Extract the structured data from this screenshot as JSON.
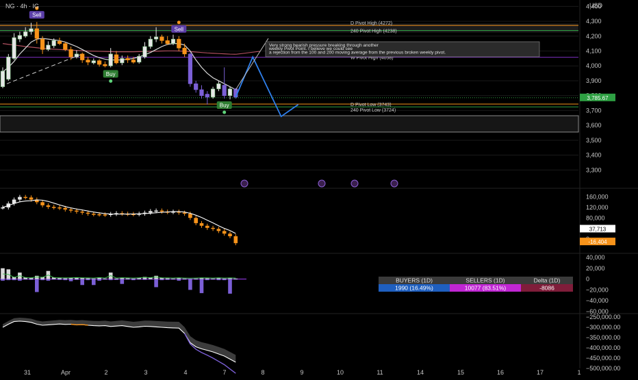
{
  "header": {
    "symbol": "NG · 4h · IG",
    "currency": "USD"
  },
  "colors": {
    "bg": "#000000",
    "up": "#e6e6e6",
    "down": "#f7931a",
    "buy": "#7b5fd6",
    "pivot": "#f7931a",
    "ma": "#d9d9d9",
    "projection": "#2f80ed",
    "accent": "#7b2fbf",
    "grid": "#1a1a1a"
  },
  "chart_data": [
    {
      "type": "candlestick",
      "title": "",
      "ylim": [
        3200,
        4420
      ],
      "y_ticks": [
        "4,400",
        "4,300",
        "4,200",
        "4,100",
        "4,000",
        "3,900",
        "3,800",
        "3,700",
        "3,600",
        "3,500",
        "3,400",
        "3,300"
      ],
      "x_ticks": [
        "31",
        "Apr",
        "2",
        "3",
        "4",
        "7",
        "8",
        "9",
        "10",
        "11",
        "14",
        "15",
        "16",
        "17",
        "1"
      ],
      "last_price": "3,785.67",
      "candles": [
        {
          "o": 3860,
          "c": 3965,
          "h": 3990,
          "l": 3850
        },
        {
          "o": 3910,
          "c": 4060,
          "h": 4080,
          "l": 3900
        },
        {
          "o": 4050,
          "c": 4190,
          "h": 4220,
          "l": 4040
        },
        {
          "o": 4180,
          "c": 4205,
          "h": 4230,
          "l": 4160
        },
        {
          "o": 4200,
          "c": 4230,
          "h": 4260,
          "l": 4190
        },
        {
          "o": 4230,
          "c": 4250,
          "h": 4290,
          "l": 4210
        },
        {
          "o": 4250,
          "c": 4185,
          "h": 4295,
          "l": 4150
        },
        {
          "o": 4180,
          "c": 4110,
          "h": 4200,
          "l": 4080
        },
        {
          "o": 4110,
          "c": 4140,
          "h": 4165,
          "l": 4100
        },
        {
          "o": 4135,
          "c": 4170,
          "h": 4185,
          "l": 4120
        },
        {
          "o": 4165,
          "c": 4150,
          "h": 4190,
          "l": 4140
        },
        {
          "o": 4150,
          "c": 4110,
          "h": 4160,
          "l": 4100
        },
        {
          "o": 4110,
          "c": 4060,
          "h": 4130,
          "l": 4040
        },
        {
          "o": 4060,
          "c": 4080,
          "h": 4105,
          "l": 4050
        },
        {
          "o": 4080,
          "c": 4040,
          "h": 4090,
          "l": 4020
        },
        {
          "o": 4040,
          "c": 4025,
          "h": 4060,
          "l": 4005
        },
        {
          "o": 4020,
          "c": 4035,
          "h": 4050,
          "l": 4010
        },
        {
          "o": 4035,
          "c": 4010,
          "h": 4045,
          "l": 3995
        },
        {
          "o": 4010,
          "c": 4000,
          "h": 4030,
          "l": 3990
        },
        {
          "o": 4000,
          "c": 4080,
          "h": 4120,
          "l": 3990
        },
        {
          "o": 4075,
          "c": 4020,
          "h": 4100,
          "l": 4010
        },
        {
          "o": 4020,
          "c": 4050,
          "h": 4070,
          "l": 4005
        },
        {
          "o": 4050,
          "c": 4040,
          "h": 4070,
          "l": 4020
        },
        {
          "o": 4040,
          "c": 4025,
          "h": 4060,
          "l": 4015
        },
        {
          "o": 4025,
          "c": 4065,
          "h": 4080,
          "l": 4015
        },
        {
          "o": 4060,
          "c": 4130,
          "h": 4160,
          "l": 4050
        },
        {
          "o": 4130,
          "c": 4180,
          "h": 4200,
          "l": 4115
        },
        {
          "o": 4180,
          "c": 4195,
          "h": 4260,
          "l": 4160
        },
        {
          "o": 4195,
          "c": 4170,
          "h": 4210,
          "l": 4150
        },
        {
          "o": 4170,
          "c": 4150,
          "h": 4200,
          "l": 4140
        },
        {
          "o": 4150,
          "c": 4180,
          "h": 4210,
          "l": 4140
        },
        {
          "o": 4180,
          "c": 4120,
          "h": 4200,
          "l": 4100
        },
        {
          "o": 4120,
          "c": 4080,
          "h": 4150,
          "l": 4060
        },
        {
          "o": 4080,
          "c": 3880,
          "h": 4090,
          "l": 3860
        },
        {
          "o": 3880,
          "c": 3840,
          "h": 3900,
          "l": 3820
        },
        {
          "o": 3840,
          "c": 3800,
          "h": 3870,
          "l": 3780
        },
        {
          "o": 3810,
          "c": 3790,
          "h": 3830,
          "l": 3740
        },
        {
          "o": 3790,
          "c": 3845,
          "h": 3860,
          "l": 3780
        },
        {
          "o": 3845,
          "c": 3880,
          "h": 3900,
          "l": 3830
        },
        {
          "o": 3870,
          "c": 3800,
          "h": 3990,
          "l": 3780
        },
        {
          "o": 3800,
          "c": 3845,
          "h": 3860,
          "l": 3775
        },
        {
          "o": 3845,
          "c": 3790,
          "h": 3850,
          "l": 3780
        }
      ],
      "ma": [
        3960,
        3990,
        4030,
        4080,
        4120,
        4160,
        4180,
        4185,
        4180,
        4175,
        4170,
        4160,
        4145,
        4130,
        4110,
        4090,
        4070,
        4055,
        4045,
        4040,
        4040,
        4040,
        4045,
        4050,
        4060,
        4075,
        4090,
        4110,
        4130,
        4145,
        4150,
        4150,
        4140,
        4100,
        4040,
        3990,
        3950,
        3920,
        3900,
        3880,
        3860,
        3840
      ],
      "long_ma": [
        4150,
        4145,
        4140,
        4135,
        4130,
        4126,
        4122,
        4118,
        4115,
        4112,
        4110,
        4108,
        4106,
        4104,
        4102,
        4100,
        4099,
        4098,
        4097,
        4096,
        4095,
        4095,
        4095,
        4095,
        4096,
        4097,
        4098,
        4099,
        4100,
        4101,
        4101,
        4100,
        4099,
        4096,
        4093,
        4090,
        4087,
        4085,
        4083,
        4081,
        4079,
        4078
      ],
      "levels": [
        {
          "label": "D Pivot High (4272)",
          "value": 4272
        },
        {
          "label": "240 Pivot High (4238)",
          "value": 4238
        },
        {
          "label": "W Pivot High (4058)",
          "value": 4058
        },
        {
          "label": "D Pivot Low (3743)",
          "value": 3743
        },
        {
          "label": "240 Pivot Low (3724)",
          "value": 3724
        }
      ],
      "projection": [
        [
          41,
          3790
        ],
        [
          44,
          4060
        ],
        [
          49,
          3660
        ],
        [
          52,
          3740
        ]
      ],
      "annotation": "Very strong bearish pressure breaking through another weekly Pivot Point. I believe we could see a rejection from the 100 and 200 moving average from the previous broken weekly pivot.",
      "signals": [
        {
          "label": "Sell",
          "index": 6
        },
        {
          "label": "Buy",
          "index": 19
        },
        {
          "label": "Sell",
          "index": 31
        },
        {
          "label": "Buy",
          "index": 39
        }
      ]
    },
    {
      "type": "bar",
      "ylim": [
        -50000,
        180000
      ],
      "y_ticks": [
        "160,000",
        "120,000",
        "80,000",
        "40,000",
        "0"
      ],
      "last_value": "37,713",
      "delta_value": "-16,404",
      "ma_value": 37713
    },
    {
      "type": "bar",
      "ylim": [
        -60000,
        45000
      ],
      "y_ticks": [
        "40,000",
        "20,000",
        "0",
        "−20,000",
        "−40,000",
        "−60,000"
      ],
      "table": {
        "headers": [
          "BUYERS (1D)",
          "SELLERS (1D)",
          "Delta (1D)"
        ],
        "values": [
          "1990 (16.49%)",
          "10077 (83.51%)",
          "-8086"
        ]
      }
    },
    {
      "type": "line",
      "ylim": [
        -500000,
        -240000
      ],
      "y_ticks": [
        "−250,000.00",
        "−300,000.00",
        "−350,000.00",
        "−400,000.00",
        "−450,000.00",
        "−500,000.00"
      ]
    }
  ]
}
